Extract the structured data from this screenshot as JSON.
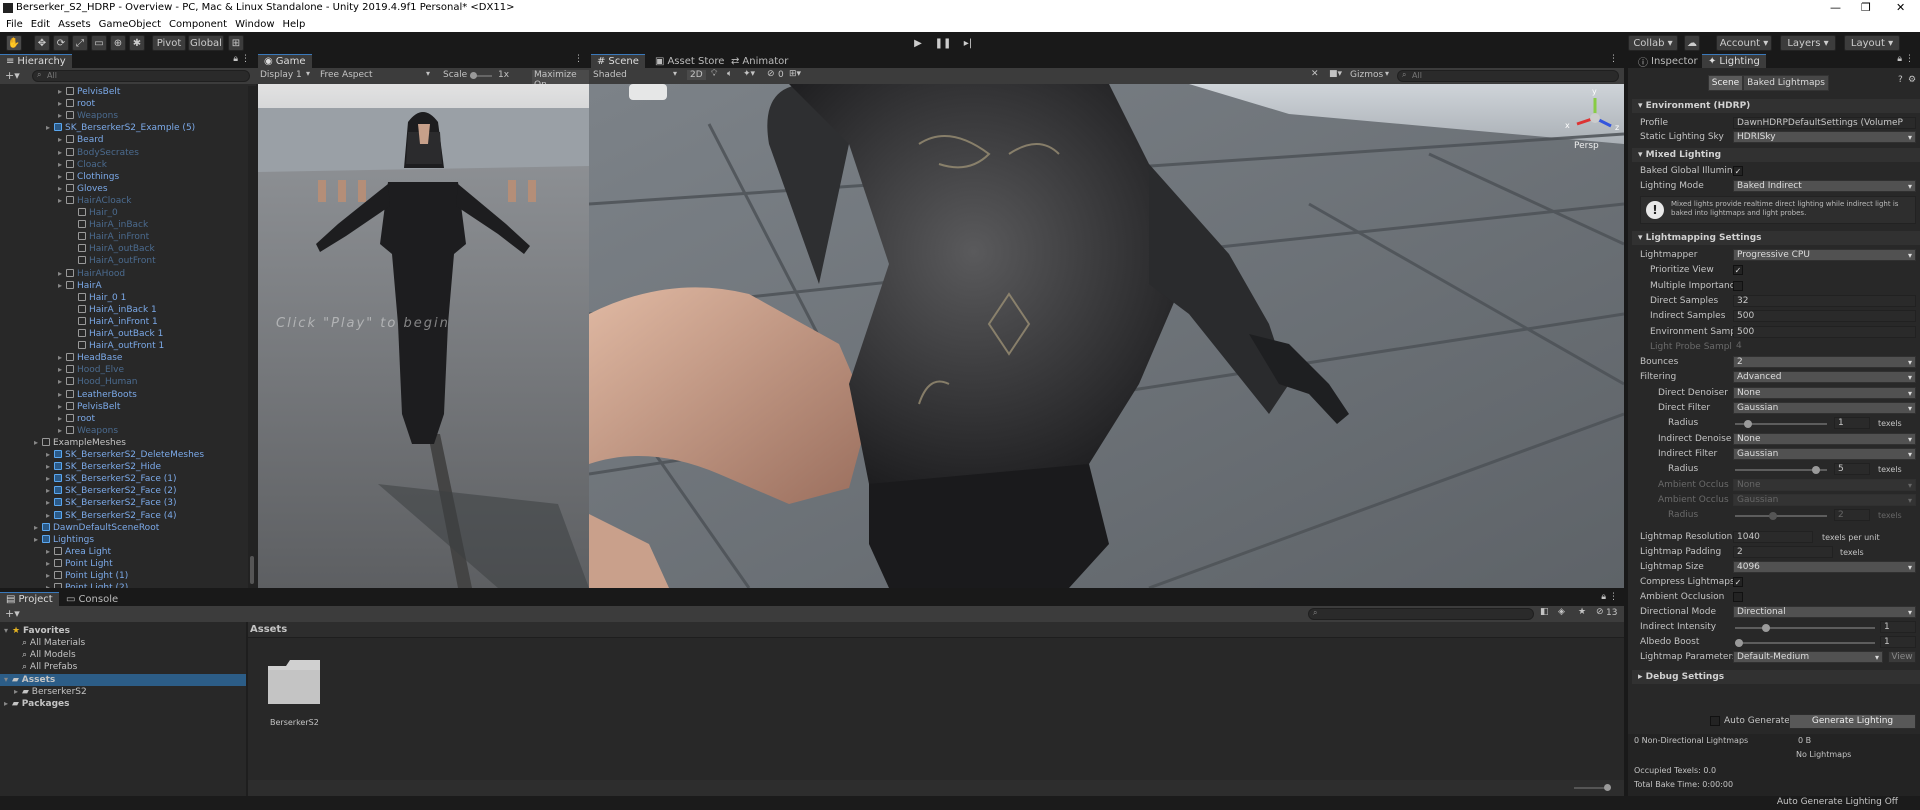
{
  "window": {
    "title": "Berserker_S2_HDRP - Overview - PC, Mac & Linux Standalone - Unity 2019.4.9f1 Personal* <DX11>",
    "min": "—",
    "max": "❐",
    "close": "✕"
  },
  "menu": [
    "File",
    "Edit",
    "Assets",
    "GameObject",
    "Component",
    "Window",
    "Help"
  ],
  "toolbar": {
    "pivot": "Pivot",
    "global": "Global",
    "collab": "Collab ▾",
    "account": "Account ▾",
    "layers": "Layers ▾",
    "layout": "Layout ▾"
  },
  "hierarchy": {
    "tab": "Hierarchy",
    "search_placeholder": "All",
    "items": [
      {
        "label": "PelvisBelt",
        "indent": 2,
        "style": "blue"
      },
      {
        "label": "root",
        "indent": 2,
        "style": "blue"
      },
      {
        "label": "Weapons",
        "indent": 2,
        "style": "dim"
      },
      {
        "label": "SK_BerserkerS2_Example (5)",
        "indent": 1,
        "style": "blue",
        "prefab": true
      },
      {
        "label": "Beard",
        "indent": 2,
        "style": "blue"
      },
      {
        "label": "BodySecrates",
        "indent": 2,
        "style": "dim"
      },
      {
        "label": "Cloack",
        "indent": 2,
        "style": "dim"
      },
      {
        "label": "Clothings",
        "indent": 2,
        "style": "blue"
      },
      {
        "label": "Gloves",
        "indent": 2,
        "style": "blue"
      },
      {
        "label": "HairACloack",
        "indent": 2,
        "style": "dim"
      },
      {
        "label": "Hair_0",
        "indent": 3,
        "style": "dim"
      },
      {
        "label": "HairA_inBack",
        "indent": 3,
        "style": "dim"
      },
      {
        "label": "HairA_inFront",
        "indent": 3,
        "style": "dim"
      },
      {
        "label": "HairA_outBack",
        "indent": 3,
        "style": "dim"
      },
      {
        "label": "HairA_outFront",
        "indent": 3,
        "style": "dim"
      },
      {
        "label": "HairAHood",
        "indent": 2,
        "style": "dim"
      },
      {
        "label": "HairA",
        "indent": 2,
        "style": "blue"
      },
      {
        "label": "Hair_0 1",
        "indent": 3,
        "style": "blue"
      },
      {
        "label": "HairA_inBack 1",
        "indent": 3,
        "style": "blue"
      },
      {
        "label": "HairA_inFront 1",
        "indent": 3,
        "style": "blue"
      },
      {
        "label": "HairA_outBack 1",
        "indent": 3,
        "style": "blue"
      },
      {
        "label": "HairA_outFront 1",
        "indent": 3,
        "style": "blue"
      },
      {
        "label": "HeadBase",
        "indent": 2,
        "style": "blue"
      },
      {
        "label": "Hood_Elve",
        "indent": 2,
        "style": "dim"
      },
      {
        "label": "Hood_Human",
        "indent": 2,
        "style": "dim"
      },
      {
        "label": "LeatherBoots",
        "indent": 2,
        "style": "blue"
      },
      {
        "label": "PelvisBelt",
        "indent": 2,
        "style": "blue"
      },
      {
        "label": "root",
        "indent": 2,
        "style": "blue"
      },
      {
        "label": "Weapons",
        "indent": 2,
        "style": "dim"
      },
      {
        "label": "ExampleMeshes",
        "indent": 0,
        "style": "plain"
      },
      {
        "label": "SK_BerserkerS2_DeleteMeshes",
        "indent": 1,
        "style": "blue",
        "prefab": true
      },
      {
        "label": "SK_BerserkerS2_Hide",
        "indent": 1,
        "style": "blue",
        "prefab": true
      },
      {
        "label": "SK_BerserkerS2_Face (1)",
        "indent": 1,
        "style": "blue",
        "prefab": true
      },
      {
        "label": "SK_BerserkerS2_Face (2)",
        "indent": 1,
        "style": "blue",
        "prefab": true
      },
      {
        "label": "SK_BerserkerS2_Face (3)",
        "indent": 1,
        "style": "blue",
        "prefab": true
      },
      {
        "label": "SK_BerserkerS2_Face (4)",
        "indent": 1,
        "style": "blue",
        "prefab": true
      },
      {
        "label": "DawnDefaultSceneRoot",
        "indent": 0,
        "style": "blue",
        "prefab": true
      },
      {
        "label": "Lightings",
        "indent": 0,
        "style": "blue",
        "prefab": true
      },
      {
        "label": "Area Light",
        "indent": 1,
        "style": "blue"
      },
      {
        "label": "Point Light",
        "indent": 1,
        "style": "blue"
      },
      {
        "label": "Point Light (1)",
        "indent": 1,
        "style": "blue"
      },
      {
        "label": "Point Light (2)",
        "indent": 1,
        "style": "blue"
      }
    ]
  },
  "game": {
    "tab": "Game",
    "display": "Display 1",
    "aspect": "Free Aspect",
    "scale_label": "Scale",
    "scale_value": "1x",
    "maximize": "Maximize On",
    "overlay_text": "Click \"Play\" to begin"
  },
  "scene": {
    "tabs": [
      "Scene",
      "Asset Store",
      "Animator"
    ],
    "shading": "Shaded",
    "mode2d": "2D",
    "fx_count": "0",
    "gizmos": "Gizmos",
    "search_placeholder": "All",
    "persp": "Persp",
    "axis_x": "x",
    "axis_y": "y",
    "axis_z": "z"
  },
  "project": {
    "tabs": [
      "Project",
      "Console"
    ],
    "favorites": "Favorites",
    "fav_items": [
      "All Materials",
      "All Models",
      "All Prefabs"
    ],
    "assets": "Assets",
    "asset_items": [
      "BerserkerS2"
    ],
    "packages": "Packages",
    "breadcrumb": "Assets",
    "folder_label": "BerserkerS2",
    "count": "13"
  },
  "inspector": {
    "tabs": [
      "Inspector",
      "Lighting"
    ],
    "subtabs": [
      "Scene",
      "Baked Lightmaps"
    ],
    "env_title": "Environment (HDRP)",
    "profile_label": "Profile",
    "profile_value": "DawnHDRPDefaultSettings (VolumeP",
    "sky_label": "Static Lighting Sky",
    "sky_value": "HDRISky",
    "mixed_title": "Mixed Lighting",
    "bgi_label": "Baked Global Illumina",
    "mode_label": "Lighting Mode",
    "mode_value": "Baked Indirect",
    "info": "Mixed lights provide realtime direct lighting while indirect light is baked into lightmaps and light probes.",
    "lm_title": "Lightmapping Settings",
    "rows": [
      {
        "label": "Lightmapper",
        "value": "Progressive CPU",
        "type": "dd"
      },
      {
        "label": "Prioritize View",
        "type": "chk",
        "checked": "✓"
      },
      {
        "label": "Multiple Importanc",
        "type": "chk",
        "checked": ""
      },
      {
        "label": "Direct Samples",
        "value": "32",
        "type": "val"
      },
      {
        "label": "Indirect Samples",
        "value": "500",
        "type": "val"
      },
      {
        "label": "Environment Samp",
        "value": "500",
        "type": "val"
      },
      {
        "label": "Light Probe Sampl",
        "value": "4",
        "type": "valdim"
      },
      {
        "label": "Bounces",
        "value": "2",
        "type": "dd"
      },
      {
        "label": "Filtering",
        "value": "Advanced",
        "type": "dd"
      },
      {
        "label": "Direct Denoiser",
        "value": "None",
        "type": "dd"
      },
      {
        "label": "Direct Filter",
        "value": "Gaussian",
        "type": "dd"
      },
      {
        "label": "Radius",
        "value": "1",
        "unit": "texels",
        "type": "slider",
        "pos": 0.1
      },
      {
        "label": "Indirect Denoise",
        "value": "None",
        "type": "dd"
      },
      {
        "label": "Indirect Filter",
        "value": "Gaussian",
        "type": "dd"
      },
      {
        "label": "Radius",
        "value": "5",
        "unit": "texels",
        "type": "slider",
        "pos": 0.9
      },
      {
        "label": "Ambient Occlus",
        "value": "None",
        "type": "dddim"
      },
      {
        "label": "Ambient Occlus",
        "value": "Gaussian",
        "type": "dddim"
      },
      {
        "label": "Radius",
        "value": "2",
        "unit": "texels",
        "type": "sliderdim",
        "pos": 0.4
      }
    ],
    "res_label": "Lightmap Resolution",
    "res_value": "1040",
    "res_unit": "texels per unit",
    "pad_label": "Lightmap Padding",
    "pad_value": "2",
    "pad_unit": "texels",
    "size_label": "Lightmap Size",
    "size_value": "4096",
    "compress_label": "Compress Lightmaps",
    "ao_label": "Ambient Occlusion",
    "dir_label": "Directional Mode",
    "dir_value": "Directional",
    "ii_label": "Indirect Intensity",
    "ii_value": "1",
    "ab_label": "Albedo Boost",
    "ab_value": "1",
    "params_label": "Lightmap Parameters",
    "params_value": "Default-Medium",
    "view": "View",
    "debug_title": "Debug Settings",
    "auto_gen": "Auto Generate",
    "gen_btn": "Generate Lighting",
    "stats_maps": "0 Non-Directional Lightmaps",
    "stats_size": "0 B",
    "stats_none": "No Lightmaps",
    "occupied": "Occupied Texels: 0.0",
    "bake_time": "Total Bake Time: 0:00:00"
  },
  "status": {
    "right": "Auto Generate Lighting Off"
  }
}
